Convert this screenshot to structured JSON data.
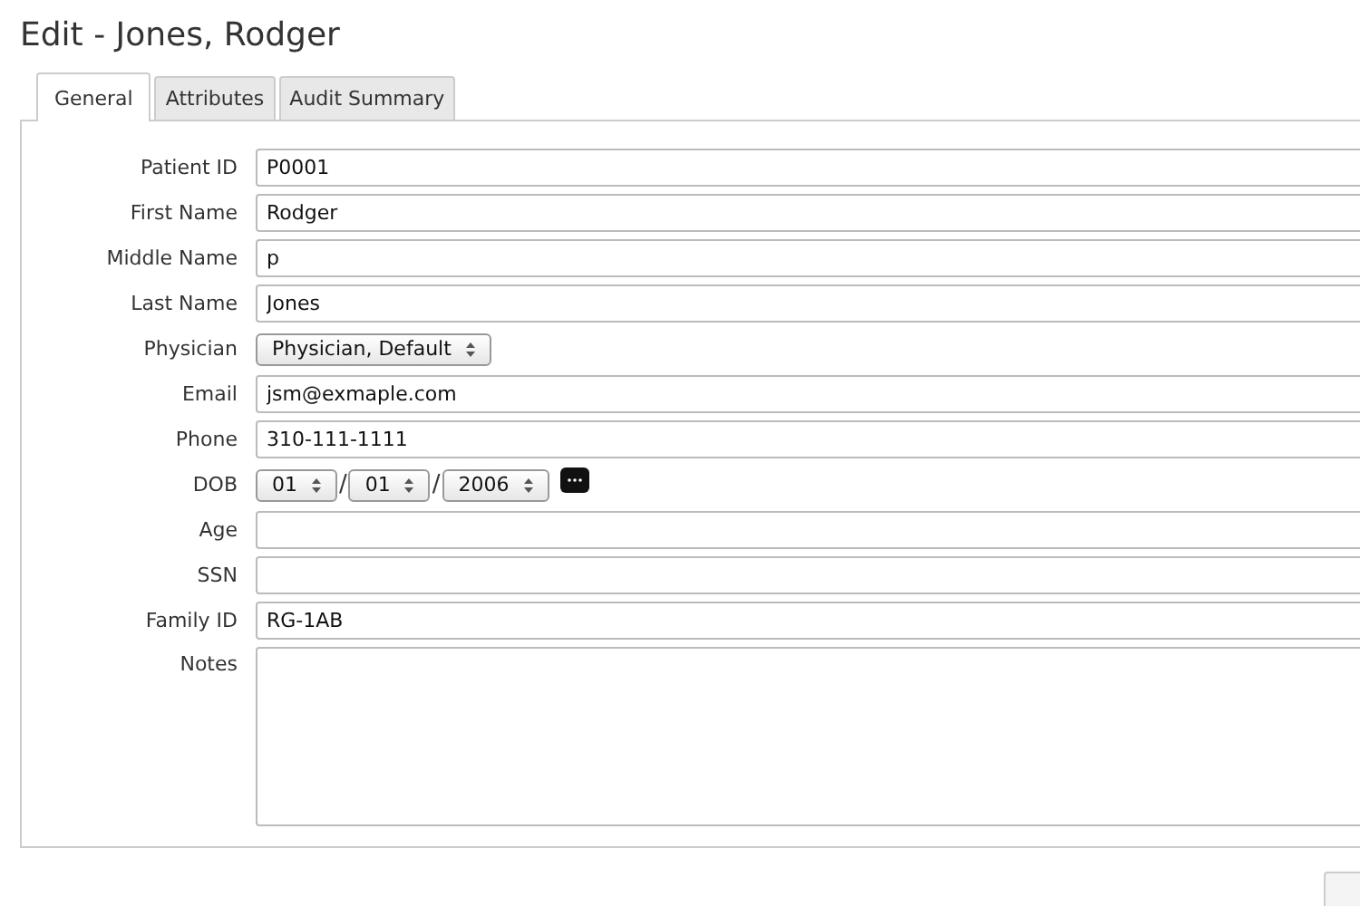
{
  "title": "Edit - Jones, Rodger",
  "tabs": [
    {
      "label": "General",
      "selected": true
    },
    {
      "label": "Attributes",
      "selected": false
    },
    {
      "label": "Audit Summary",
      "selected": false
    }
  ],
  "fields": [
    {
      "kind": "text",
      "label": "Patient ID",
      "value": "P0001"
    },
    {
      "kind": "text",
      "label": "First Name",
      "value": "Rodger"
    },
    {
      "kind": "text",
      "label": "Middle Name",
      "value": "p"
    },
    {
      "kind": "text",
      "label": "Last Name",
      "value": "Jones"
    },
    {
      "kind": "select",
      "label": "Physician",
      "value": "Physician, Default"
    },
    {
      "kind": "text",
      "label": "Email",
      "value": "jsm@exmaple.com"
    },
    {
      "kind": "text",
      "label": "Phone",
      "value": "310-111-1111"
    },
    {
      "kind": "date",
      "label": "DOB",
      "parts": [
        "01",
        "01",
        "2006"
      ],
      "separators": [
        "/",
        "/"
      ]
    },
    {
      "kind": "text",
      "label": "Age"
    },
    {
      "kind": "text",
      "label": "SSN"
    },
    {
      "kind": "text",
      "label": "Family ID",
      "value": "RG-1AB"
    },
    {
      "kind": "textarea",
      "label": "Notes"
    }
  ]
}
